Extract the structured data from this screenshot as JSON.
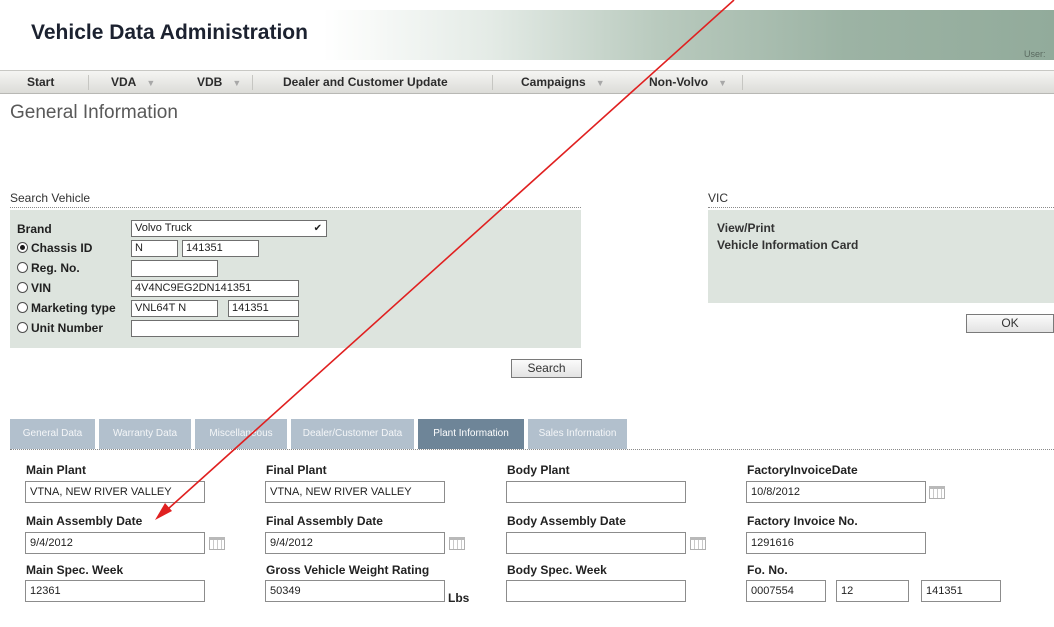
{
  "header": {
    "app_title": "Vehicle Data Administration",
    "user_label": "User:"
  },
  "menu": [
    {
      "label": "Start",
      "caret": ""
    },
    {
      "label": "VDA",
      "caret": "▼"
    },
    {
      "label": "VDB",
      "caret": "▼"
    },
    {
      "label": "Dealer and Customer Update",
      "caret": ""
    },
    {
      "label": "Campaigns",
      "caret": "▼"
    },
    {
      "label": "Non-Volvo",
      "caret": "▼"
    }
  ],
  "page_title": "General Information",
  "search": {
    "section_title": "Search Vehicle",
    "brand_label": "Brand",
    "brand_value": "Volvo Truck",
    "chassis_label": "Chassis ID",
    "chassis_series": "N",
    "chassis_number": "141351",
    "reg_label": "Reg. No.",
    "reg_value": "",
    "vin_label": "VIN",
    "vin_value": "4V4NC9EG2DN141351",
    "marketing_label": "Marketing type",
    "marketing_type": "VNL64T N",
    "marketing_number": "141351",
    "unit_label": "Unit Number",
    "unit_value": "",
    "selected_option": "Chassis ID",
    "search_button": "Search"
  },
  "vic": {
    "section_title": "VIC",
    "view_print": "View/Print",
    "card": "Vehicle Information Card",
    "ok_button": "OK"
  },
  "tabs": [
    {
      "label": "General Data",
      "active": false
    },
    {
      "label": "Warranty Data",
      "active": false
    },
    {
      "label": "Miscellaneous",
      "active": false
    },
    {
      "label": "Dealer/Customer Data",
      "active": false
    },
    {
      "label": "Plant Information",
      "active": true
    },
    {
      "label": "Sales Information",
      "active": false
    }
  ],
  "plant": {
    "main_plant_label": "Main Plant",
    "main_plant": "VTNA, NEW RIVER VALLEY",
    "final_plant_label": "Final Plant",
    "final_plant": "VTNA, NEW RIVER VALLEY",
    "body_plant_label": "Body Plant",
    "body_plant": "",
    "factory_invoice_date_label": "FactoryInvoiceDate",
    "factory_invoice_date": "10/8/2012",
    "main_assembly_label": "Main Assembly Date",
    "main_assembly_date": "9/4/2012",
    "final_assembly_label": "Final Assembly Date",
    "final_assembly_date": "9/4/2012",
    "body_assembly_label": "Body Assembly Date",
    "body_assembly_date": "",
    "factory_invoice_no_label": "Factory Invoice No.",
    "factory_invoice_no": "1291616",
    "main_spec_label": "Main Spec. Week",
    "main_spec_week": "12361",
    "gvwr_label": "Gross Vehicle Weight Rating",
    "gvwr": "50349",
    "gvwr_unit": "Lbs",
    "body_spec_label": "Body Spec. Week",
    "body_spec_week": "",
    "fo_label": "Fo. No.",
    "fo_1": "0007554",
    "fo_2": "12",
    "fo_3": "141351"
  },
  "colors": {
    "panel": "#dde4de",
    "tab": "#b2c0cd",
    "tab_active": "#6e8598",
    "annotation": "#e02020"
  },
  "annotation": {
    "type": "red-arrow",
    "points_to": "main-assembly-date-label"
  }
}
